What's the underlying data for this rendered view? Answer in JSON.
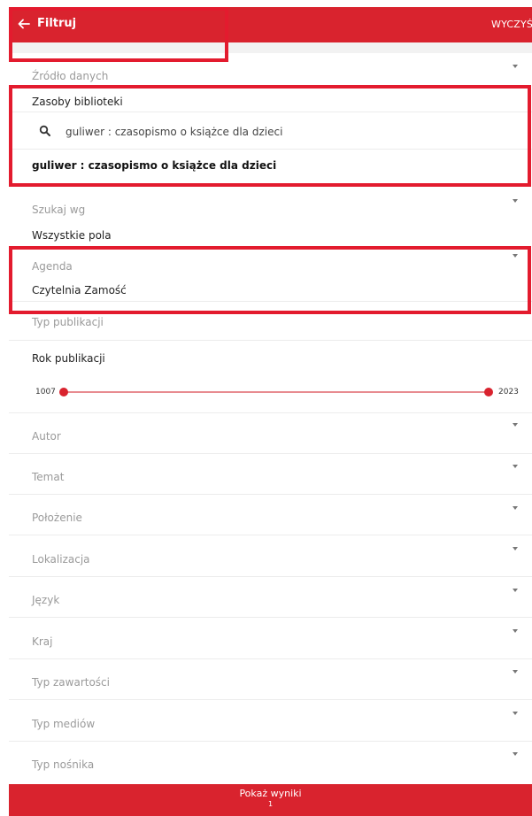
{
  "header": {
    "title": "Filtruj",
    "clear_label": "WYCZYŚ"
  },
  "source": {
    "label": "Źródło danych",
    "value": "Zasoby biblioteki",
    "search_value": "guliwer : czasopismo o książce dla dzieci",
    "result": "guliwer : czasopismo o książce dla dzieci"
  },
  "search_by": {
    "label": "Szukaj wg",
    "value": "Wszystkie pola"
  },
  "agenda": {
    "label": "Agenda",
    "value": "Czytelnia Zamość"
  },
  "pub_type": {
    "label": "Typ publikacji"
  },
  "pub_year": {
    "label": "Rok publikacji",
    "min": "1007",
    "max": "2023",
    "range_start_fraction": 0,
    "range_end_fraction": 1
  },
  "filters": [
    {
      "label": "Autor"
    },
    {
      "label": "Temat"
    },
    {
      "label": "Położenie"
    },
    {
      "label": "Lokalizacja"
    },
    {
      "label": "Język"
    },
    {
      "label": "Kraj"
    },
    {
      "label": "Typ zawartości"
    },
    {
      "label": "Typ mediów"
    },
    {
      "label": "Typ nośnika"
    }
  ],
  "footer": {
    "show_results_label": "Pokaż wyniki",
    "count": "1"
  },
  "colors": {
    "accent": "#d9232e",
    "highlight": "#e31b2e"
  }
}
